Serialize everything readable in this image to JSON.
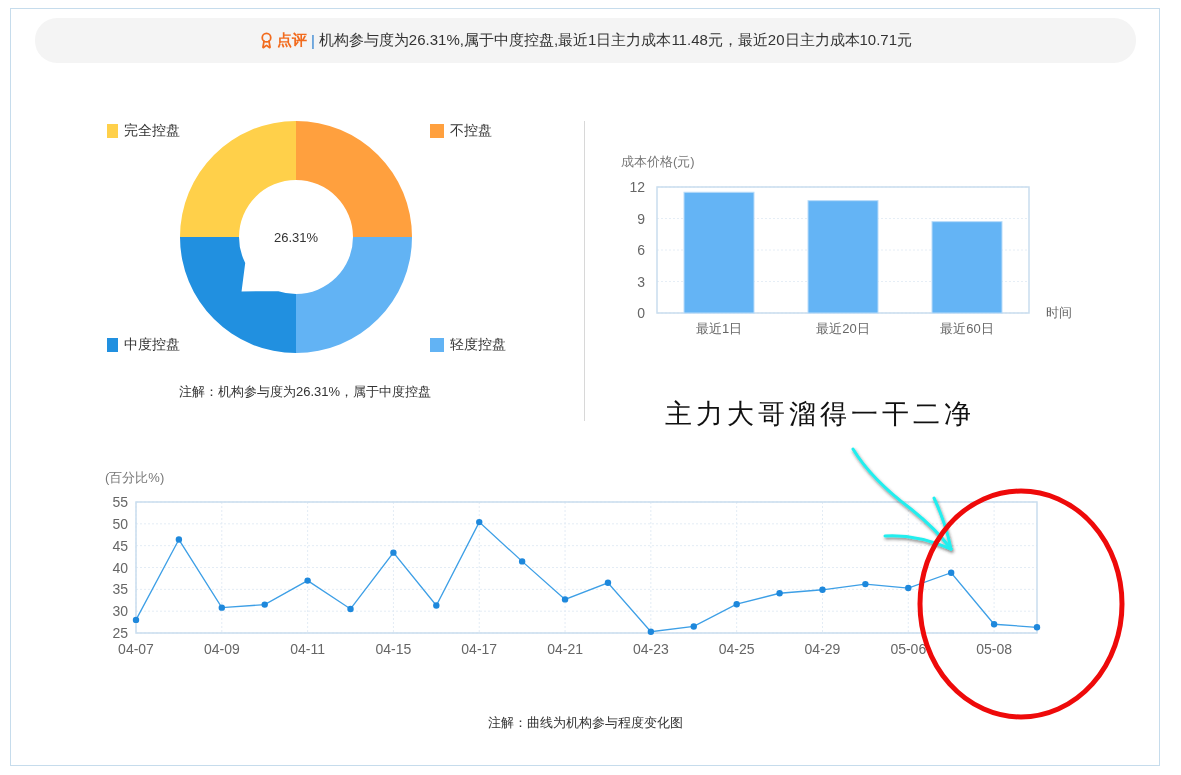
{
  "header": {
    "badge": "点评",
    "separator": "|",
    "text": "机构参与度为26.31%,属于中度控盘,最近1日主力成本11.48元，最近20日主力成本10.71元"
  },
  "donut": {
    "center_label": "26.31%",
    "legend": [
      {
        "label": "完全控盘",
        "color": "#ffd04a",
        "highlighted": false
      },
      {
        "label": "不控盘",
        "color": "#ffa03e",
        "highlighted": false
      },
      {
        "label": "中度控盘",
        "color": "#2190e0",
        "highlighted": true
      },
      {
        "label": "轻度控盘",
        "color": "#62b3f4",
        "highlighted": false
      }
    ],
    "note": "注解：机构参与度为26.31%，属于中度控盘"
  },
  "cost_chart": {
    "chart_data": {
      "type": "bar",
      "ylabel": "成本价格(元)",
      "xlabel": "时间",
      "categories": [
        "最近1日",
        "最近20日",
        "最近60日"
      ],
      "values": [
        11.5,
        10.7,
        8.7
      ],
      "grid": true,
      "ylim": [
        0,
        12
      ],
      "yticks": [
        0,
        3,
        6,
        9,
        12
      ]
    }
  },
  "trend_chart": {
    "chart_data": {
      "type": "line",
      "ylabel": "(百分比%)",
      "categories": [
        "04-07",
        null,
        "04-09",
        null,
        "04-11",
        null,
        "04-15",
        null,
        "04-17",
        null,
        "04-21",
        null,
        "04-23",
        null,
        "04-25",
        null,
        "04-29",
        null,
        "05-06",
        null,
        "05-08",
        null
      ],
      "grid": true,
      "values": [
        28.0,
        46.4,
        30.8,
        31.5,
        37.0,
        30.5,
        43.4,
        31.3,
        50.4,
        41.4,
        32.7,
        36.5,
        25.3,
        26.5,
        31.6,
        34.1,
        34.9,
        36.2,
        35.3,
        38.8,
        27.0,
        26.3
      ],
      "ylim": [
        25,
        55
      ],
      "yticks": [
        25,
        30,
        35,
        40,
        45,
        50,
        55
      ],
      "marker": true
    },
    "note": "注解：曲线为机构参与程度变化图"
  },
  "annotation": {
    "text": "主力大哥溜得一干二净"
  }
}
